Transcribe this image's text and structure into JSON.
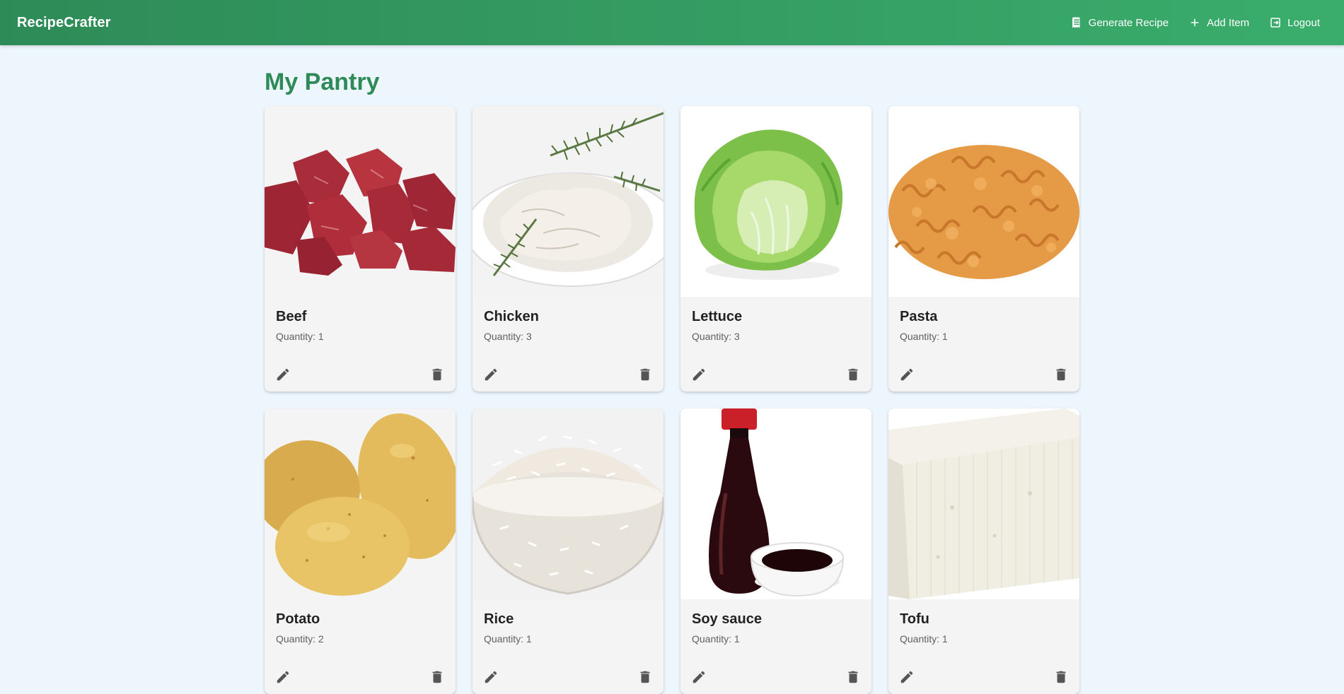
{
  "app": {
    "title": "RecipeCrafter"
  },
  "nav": {
    "generate_label": "Generate Recipe",
    "add_label": "Add Item",
    "logout_label": "Logout"
  },
  "page": {
    "title": "My Pantry"
  },
  "colors": {
    "brand": "#2e8b57",
    "brand_light": "#3aad6c",
    "background": "#eef6fd",
    "card": "#f4f4f4"
  },
  "pantry": {
    "items": [
      {
        "name": "Beef",
        "quantity": "Quantity: 1",
        "image": "beef-image"
      },
      {
        "name": "Chicken",
        "quantity": "Quantity: 3",
        "image": "chicken-image"
      },
      {
        "name": "Lettuce",
        "quantity": "Quantity: 3",
        "image": "lettuce-image"
      },
      {
        "name": "Pasta",
        "quantity": "Quantity: 1",
        "image": "pasta-image"
      },
      {
        "name": "Potato",
        "quantity": "Quantity: 2",
        "image": "potato-image"
      },
      {
        "name": "Rice",
        "quantity": "Quantity: 1",
        "image": "rice-image"
      },
      {
        "name": "Soy sauce",
        "quantity": "Quantity: 1",
        "image": "soy-sauce-image"
      },
      {
        "name": "Tofu",
        "quantity": "Quantity: 1",
        "image": "tofu-image"
      }
    ]
  }
}
